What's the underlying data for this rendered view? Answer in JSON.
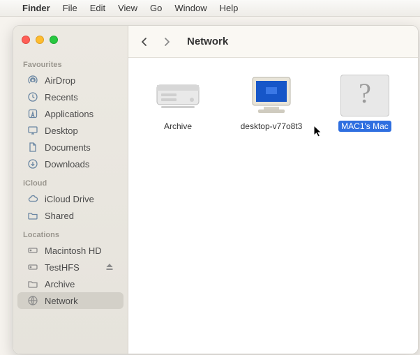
{
  "menubar": {
    "app": "Finder",
    "items": [
      "File",
      "Edit",
      "View",
      "Go",
      "Window",
      "Help"
    ]
  },
  "window": {
    "title": "Network"
  },
  "sidebar": {
    "sections": [
      {
        "title": "Favourites",
        "items": [
          {
            "icon": "airdrop",
            "label": "AirDrop"
          },
          {
            "icon": "clock",
            "label": "Recents"
          },
          {
            "icon": "app",
            "label": "Applications"
          },
          {
            "icon": "desktop",
            "label": "Desktop"
          },
          {
            "icon": "doc",
            "label": "Documents"
          },
          {
            "icon": "download",
            "label": "Downloads"
          }
        ]
      },
      {
        "title": "iCloud",
        "items": [
          {
            "icon": "cloud",
            "label": "iCloud Drive"
          },
          {
            "icon": "folder",
            "label": "Shared"
          }
        ]
      },
      {
        "title": "Locations",
        "items": [
          {
            "icon": "hdd",
            "label": "Macintosh HD"
          },
          {
            "icon": "hdd",
            "label": "TestHFS",
            "eject": true
          },
          {
            "icon": "folder",
            "label": "Archive"
          },
          {
            "icon": "globe",
            "label": "Network",
            "selected": true
          }
        ]
      }
    ]
  },
  "network_items": [
    {
      "kind": "server",
      "label": "Archive"
    },
    {
      "kind": "pc",
      "label": "desktop-v77o8t3"
    },
    {
      "kind": "unknown",
      "label": "MAC1's Mac",
      "selected": true
    }
  ]
}
